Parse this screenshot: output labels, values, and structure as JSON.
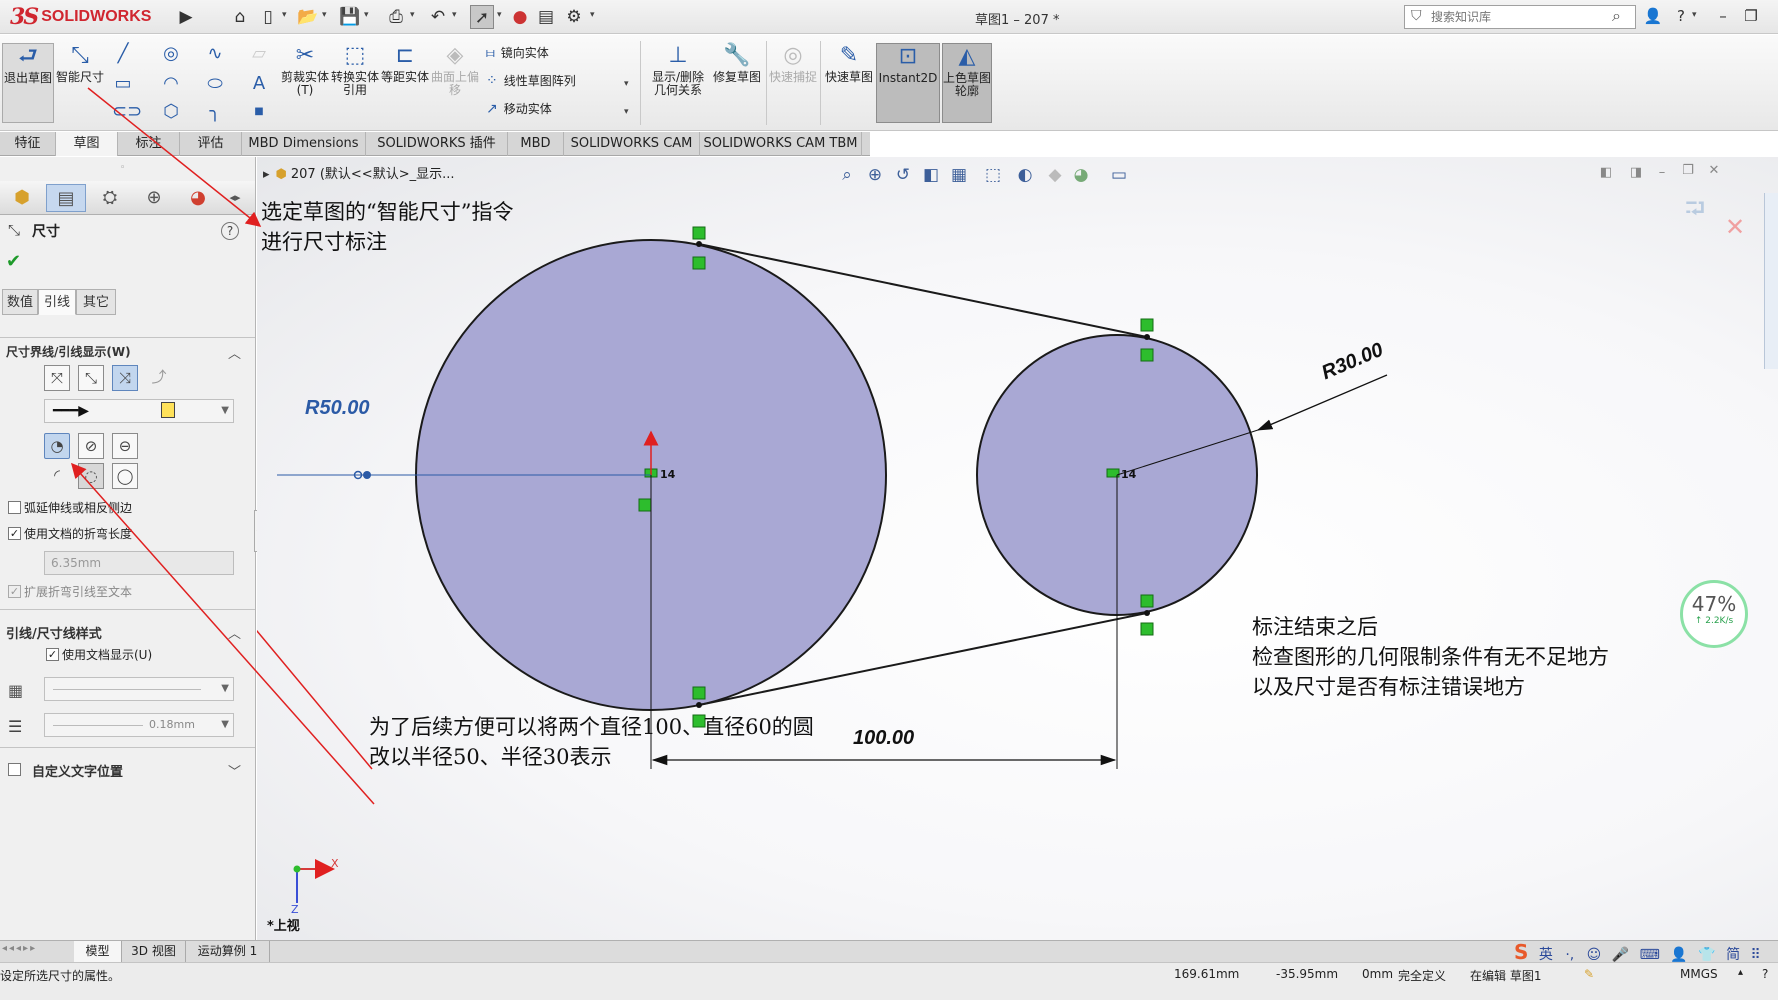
{
  "app": {
    "brand": "SOLIDWORKS",
    "doc_title": "草图1 – 207 *"
  },
  "search": {
    "placeholder": "搜索知识库"
  },
  "commands": {
    "exit_sketch": "退出草图",
    "smart_dim": "智能尺寸",
    "trim": "剪裁实体(T)",
    "convert": "转换实体引用",
    "offset": "等距实体",
    "surface_offset": "曲面上偏移",
    "mirror": "镜向实体",
    "linear_pattern": "线性草图阵列",
    "move": "移动实体",
    "show_relations": "显示/删除几何关系",
    "repair": "修复草图",
    "rapid_snap": "快速捕捉",
    "rapid_sketch": "快速草图",
    "instant2d": "Instant2D",
    "shaded_contours": "上色草图轮廓"
  },
  "tabs": [
    "特征",
    "草图",
    "标注",
    "评估",
    "MBD Dimensions",
    "SOLIDWORKS 插件",
    "MBD",
    "SOLIDWORKS CAM",
    "SOLIDWORKS CAM TBM"
  ],
  "panel": {
    "title": "尺寸",
    "subtabs": [
      "数值",
      "引线",
      "其它"
    ],
    "group1": "尺寸界线/引线显示(W)",
    "chk_arc_ext": "弧延伸线或相反侧边",
    "chk_doc_bend": "使用文档的折弯长度",
    "bend_length": "6.35mm",
    "chk_extend": "扩展折弯引线至文本",
    "group2": "引线/尺寸线样式",
    "chk_doc_display": "使用文档显示(U)",
    "line_thickness": "0.18mm",
    "group3": "自定义文字位置"
  },
  "viewport": {
    "breadcrumb": "207 (默认<<默认>_显示...",
    "view_label": "*上视",
    "axis_x": "X",
    "axis_z": "Z",
    "dims": {
      "r50": "R50.00",
      "r30": "R30.00",
      "d100": "100.00"
    },
    "small_label": "14",
    "annotation1": [
      "选定草图的“智能尺寸”指令",
      "进行尺寸标注"
    ],
    "annotation2": [
      "为了后续方便可以将两个直径100、直径60的圆",
      "改以半径50、半径30表示"
    ],
    "annotation3": [
      "标注结束之后",
      "检查图形的几何限制条件有无不足地方",
      "以及尺寸是否有标注错误地方"
    ],
    "meter_pct": "47%",
    "meter_rate": "2.2K/s"
  },
  "bottom_tabs": [
    "模型",
    "3D 视图",
    "运动算例 1"
  ],
  "ime": [
    "英",
    "·,",
    "☺",
    "🎤",
    "⌨",
    "👤",
    "👕",
    "简",
    "⠿"
  ],
  "status": {
    "message": "设定所选尺寸的属性。",
    "x": "169.61mm",
    "y": "-35.95mm",
    "z": "0mm",
    "state": "完全定义",
    "editing": "在编辑 草图1",
    "units": "MMGS"
  },
  "colors": {
    "circle_fill": "#a9a8d4",
    "dim_blue": "#2b5aa6",
    "arrow_red": "#e02020",
    "relation_green": "#2dbd2d"
  }
}
